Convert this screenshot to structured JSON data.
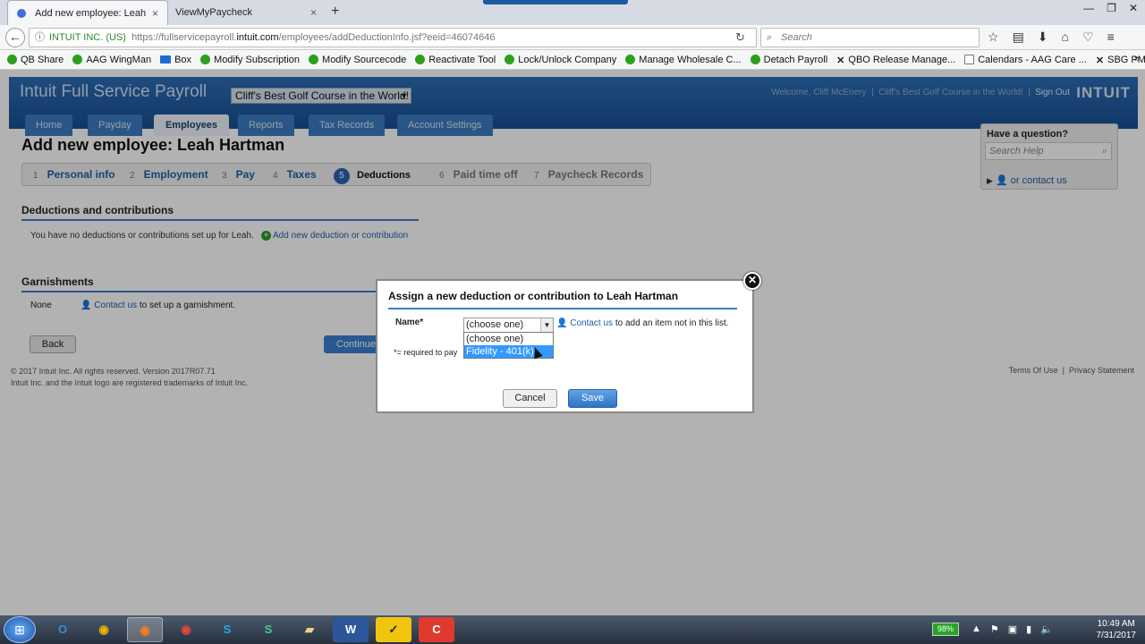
{
  "browser": {
    "tabs": [
      {
        "label": "Add new employee: Leah H",
        "close": "×"
      },
      {
        "label": "ViewMyPaycheck",
        "close": "×"
      }
    ],
    "new_tab": "+",
    "url_site": "INTUIT INC. (US)",
    "url_prefix": "https://fullservicepayroll.",
    "url_host": "intuit.com",
    "url_path": "/employees/addDeductionInfo.jsf?eeid=46074646",
    "search_placeholder": "Search",
    "bookmarks": [
      {
        "label": "QB Share",
        "icon": "quickbooks-icon"
      },
      {
        "label": "AAG WingMan",
        "icon": "quickbooks-icon"
      },
      {
        "label": "Box",
        "icon": "box-icon"
      },
      {
        "label": "Modify Subscription",
        "icon": "quickbooks-icon"
      },
      {
        "label": "Modify Sourcecode",
        "icon": "quickbooks-icon"
      },
      {
        "label": "Reactivate Tool",
        "icon": "quickbooks-icon"
      },
      {
        "label": "Lock/Unlock Company",
        "icon": "quickbooks-icon"
      },
      {
        "label": "Manage Wholesale C...",
        "icon": "quickbooks-icon"
      },
      {
        "label": "Detach Payroll",
        "icon": "quickbooks-icon"
      },
      {
        "label": "QBO Release Manage...",
        "icon": "x-icon"
      },
      {
        "label": "Calendars - AAG Care ...",
        "icon": "calendar-icon"
      },
      {
        "label": "SBG PM Directory",
        "icon": "x-icon"
      }
    ],
    "bookmarks_more": "»"
  },
  "app": {
    "title": "Intuit Full Service Payroll",
    "company": "Cliff's Best Golf Course in the World!",
    "welcome": "Welcome, Cliff McEnery",
    "company_link": "Cliff's Best Golf Course in the World!",
    "sign_out": "Sign Out",
    "logo": "INTUIT",
    "nav": [
      "Home",
      "Payday",
      "Employees",
      "Reports",
      "Tax Records",
      "Account Settings"
    ],
    "page_title": "Add new employee: Leah Hartman",
    "steps": [
      {
        "num": "1",
        "label": "Personal info"
      },
      {
        "num": "2",
        "label": "Employment"
      },
      {
        "num": "3",
        "label": "Pay"
      },
      {
        "num": "4",
        "label": "Taxes"
      },
      {
        "num": "5",
        "label": "Deductions"
      },
      {
        "num": "6",
        "label": "Paid time off"
      },
      {
        "num": "7",
        "label": "Paycheck Records"
      }
    ],
    "help": {
      "question": "Have a question?",
      "search_placeholder": "Search Help",
      "contact": "or contact us"
    },
    "deductions_heading": "Deductions and contributions",
    "no_deductions": "You have no deductions or contributions set up for Leah.",
    "add_deduction": "Add new deduction or contribution",
    "garnishments_heading": "Garnishments",
    "garn_none": "None",
    "garn_contact": "Contact us",
    "garn_text": " to set up a garnishment.",
    "back": "Back",
    "continue": "Continue",
    "footer_line1": "© 2017 Intuit Inc.  All rights reserved. Version 2017R07.71",
    "footer_line2": "Intuit Inc. and the Intuit logo are registered trademarks of Intuit Inc.",
    "terms": "Terms Of Use",
    "privacy": "Privacy Statement"
  },
  "modal": {
    "title": "Assign a new deduction or contribution to Leah Hartman",
    "name_label": "Name*",
    "selected": "(choose one)",
    "options": [
      "(choose one)",
      "Fidelity - 401(k)"
    ],
    "highlighted_option_index": 1,
    "contact_link": "Contact us",
    "contact_text": " to add an item not in this list.",
    "required_note": "*= required to pay",
    "cancel": "Cancel",
    "save": "Save"
  },
  "taskbar": {
    "apps": [
      "outlook-icon",
      "chrome-canary-icon",
      "firefox-icon",
      "chrome-icon",
      "skype-icon",
      "slack-icon",
      "folder-icon",
      "word-icon",
      "norton-icon",
      "camtasia-icon"
    ],
    "battery": "98%",
    "time": "10:49 AM",
    "date": "7/31/2017"
  }
}
